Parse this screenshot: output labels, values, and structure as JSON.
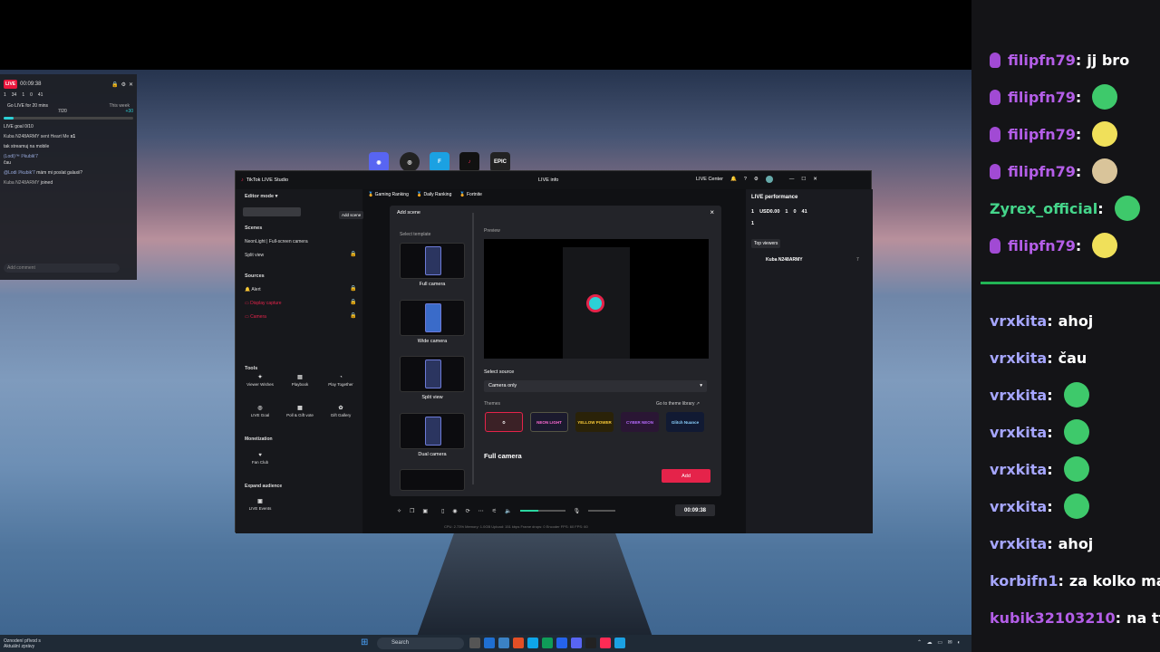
{
  "overlay": {
    "live": "LIVE",
    "timer": "00:09:38",
    "stats": [
      "1",
      "34",
      "1",
      "0",
      "41"
    ],
    "goal_title": "Go LIVE for 20 mins",
    "goal_period": "This week",
    "goal_progress": "7/20",
    "goal_reward": "+30",
    "comments": [
      {
        "user": "LIVE goal 0/10",
        "text": ""
      },
      {
        "user": "Kuba N248ARMY sent Heart Me",
        "text": "x1"
      },
      {
        "user": "",
        "text": "tak streamuj na mobile"
      },
      {
        "user": "(Lodi)™ ℙkubik'7",
        "text": "čau"
      },
      {
        "user": "@Lodi ℙkubik'7",
        "text": "mám mi poslat galaxii?"
      },
      {
        "user": "Kuba N248ARMY",
        "text": "joined"
      }
    ],
    "add_comment_placeholder": "Add comment"
  },
  "taskbar": {
    "weather_line1": "Oznodení přívod s",
    "weather_line2": "Aktuální zprávy",
    "search": "Search"
  },
  "studio": {
    "app_title": "TikTok LIVE Studio",
    "live_info": "LIVE info",
    "live_center": "LIVE Center",
    "editor_mode": "Editor mode",
    "add_scene_tooltip": "Add scene",
    "rankings": [
      "Gaming Ranking",
      "Daily Ranking",
      "Fortnite"
    ],
    "scenes_title": "Scenes",
    "scenes": [
      "NeonLight | Full-screen camera",
      "Split view"
    ],
    "sources_title": "Sources",
    "sources": [
      "Alert",
      "Display capture",
      "Camera"
    ],
    "tools_title": "Tools",
    "tools": [
      "Viewer Wishes",
      "Playbook",
      "Play Together",
      "LIVE Goal",
      "Poll & Gift vote",
      "Gift Gallery"
    ],
    "monetization_title": "Monetization",
    "fan_club": "Fan Club",
    "expand_title": "Expand audience",
    "live_events": "LIVE Events",
    "timer": "00:09:38",
    "stats": "CPU: 2.73%    Memory: 1.0GB    Upload: 151 kbps    Frame drops: 0    Encoder FPS: 60    FPS: 60"
  },
  "dialog": {
    "title": "Add scene",
    "select_template": "Select template",
    "templates": [
      "Full camera",
      "Wide camera",
      "Split view",
      "Dual camera"
    ],
    "preview": "Preview",
    "select_source": "Select source",
    "source_value": "Camera only",
    "themes": "Themes",
    "theme_library": "Go to theme library ↗",
    "theme_names": [
      "NEON LIGHT",
      "YELLOW POWER",
      "CYBER NEON",
      "Glitch Nuance"
    ],
    "selected_name": "Full camera",
    "add_button": "Add"
  },
  "performance": {
    "title": "LIVE performance",
    "stats": [
      "1",
      "USD0.00",
      "1",
      "0",
      "41"
    ],
    "likes": "1",
    "top_viewers": "Top viewers",
    "viewer_name": "Kuba N248ARMY",
    "viewer_score": "7"
  },
  "chat": [
    {
      "user": "filipfn79",
      "text": "jj bro",
      "color": "#b45ee8",
      "mic": true
    },
    {
      "user": "filipfn79",
      "text": "",
      "color": "#b45ee8",
      "mic": true
    },
    {
      "user": "filipfn79",
      "text": "",
      "color": "#b45ee8",
      "mic": true
    },
    {
      "user": "filipfn79",
      "text": "",
      "color": "#b45ee8",
      "mic": true
    },
    {
      "user": "Zyrex_official",
      "text": "",
      "color": "#45d68b",
      "mic": false
    },
    {
      "user": "filipfn79",
      "text": "",
      "color": "#b45ee8",
      "mic": true
    },
    {
      "user": "vrxkita",
      "text": "ahoj",
      "color": "#a6a6ff",
      "mic": false
    },
    {
      "user": "vrxkita",
      "text": "čau",
      "color": "#a6a6ff",
      "mic": false
    },
    {
      "user": "vrxkita",
      "text": "",
      "color": "#a6a6ff",
      "mic": false
    },
    {
      "user": "vrxkita",
      "text": "",
      "color": "#a6a6ff",
      "mic": false
    },
    {
      "user": "vrxkita",
      "text": "",
      "color": "#a6a6ff",
      "mic": false
    },
    {
      "user": "vrxkita",
      "text": "",
      "color": "#a6a6ff",
      "mic": false
    },
    {
      "user": "vrxkita",
      "text": "ahoj",
      "color": "#a6a6ff",
      "mic": false
    },
    {
      "user": "korbifn1",
      "text": "za kolko mas",
      "color": "#a6a6ff",
      "mic": false
    },
    {
      "user": "kubik32103210",
      "text": "na tt n",
      "color": "#b45ee8",
      "mic": false
    }
  ]
}
